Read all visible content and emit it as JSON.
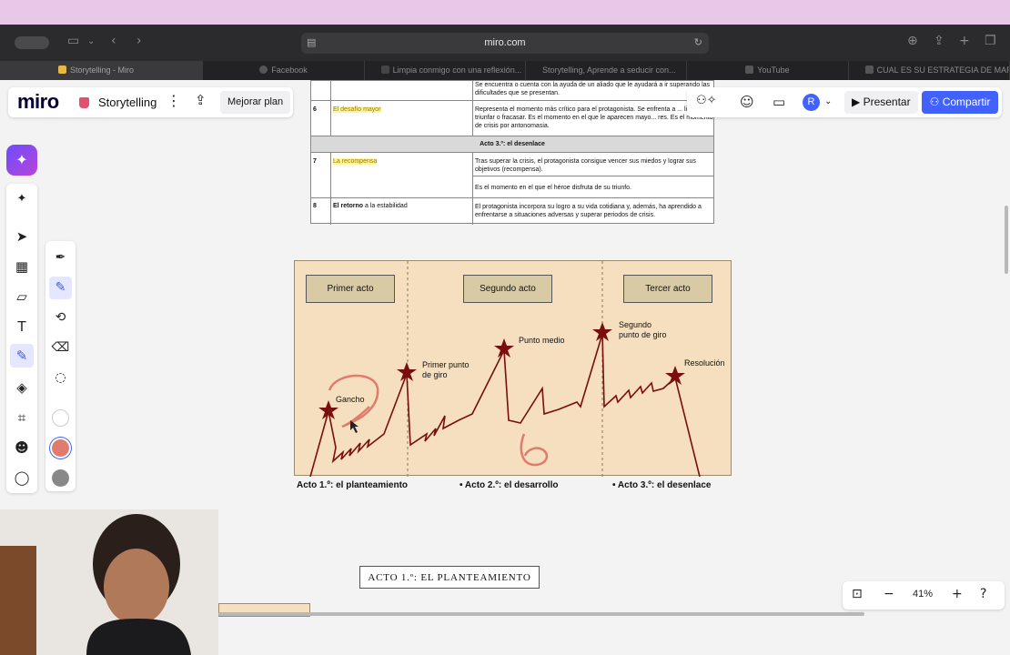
{
  "browser": {
    "url": "miro.com",
    "tabs": [
      {
        "label": "Storytelling - Miro",
        "active": true
      },
      {
        "label": "Facebook"
      },
      {
        "label": "Limpia conmigo con una reflexión..."
      },
      {
        "label": "Storytelling, Aprende a seducir con..."
      },
      {
        "label": "YouTube"
      },
      {
        "label": "CUAL ES SU ESTRATEGIA DE MAR..."
      }
    ]
  },
  "header": {
    "logo": "miro",
    "board_title": "Storytelling",
    "plan_button": "Mejorar plan",
    "avatar_initial": "R",
    "present_button": "Presentar",
    "share_button": "Compartir"
  },
  "document": {
    "rows": [
      {
        "num": "",
        "name": "",
        "desc": "Se encuentra o cuenta con la ayuda de un aliado que le ayudará a ir superando las dificultades que se presentan."
      },
      {
        "num": "6",
        "name": "El desafío mayor",
        "desc": "Representa el momento más crítico para el protagonista. Se enfrenta a ... lidad de triunfar o fracasar. Es el momento en el que le aparecen mayo... res. Es el momento de crisis por antonomasia."
      },
      {
        "num": "7",
        "name": "La recompensa",
        "desc": "Tras superar la crisis, el protagonista consigue vencer sus miedos y lograr sus objetivos (recompensa).",
        "desc2": "Es el momento en el que el héroe disfruta de su triunfo."
      },
      {
        "num": "8",
        "name_bold": "El retorno",
        "name_rest": " a la estabilidad",
        "desc": "El protagonista incorpora su logro a su vida cotidiana y, además, ha aprendido a enfrentarse a situaciones adversas y superar periodos de crisis."
      }
    ],
    "act_header": "Acto 3.º: el desenlace"
  },
  "diagram": {
    "acts": [
      "Primer acto",
      "Segundo acto",
      "Tercer acto"
    ],
    "points": {
      "gancho": "Gancho",
      "primer_punto_1": "Primer punto",
      "primer_punto_2": "de giro",
      "punto_medio": "Punto medio",
      "segundo_punto_1": "Segundo",
      "segundo_punto_2": "punto de giro",
      "resolucion": "Resolución"
    },
    "captions": [
      "Acto 1.º: el planteamiento",
      "• Acto 2.º: el desarrollo",
      "• Acto 3.º: el desenlace"
    ],
    "colors": {
      "line": "#7a0d0d",
      "star": "#7a0d0d",
      "annotation": "#e07b6d",
      "background": "#f5dfbe"
    }
  },
  "section_title": "ACTO 1.º: EL PLANTEAMIENTO",
  "zoom": {
    "value": "41%"
  },
  "tools": {
    "colors": [
      "#ffffff",
      "#e07b6d",
      "#888888"
    ]
  }
}
